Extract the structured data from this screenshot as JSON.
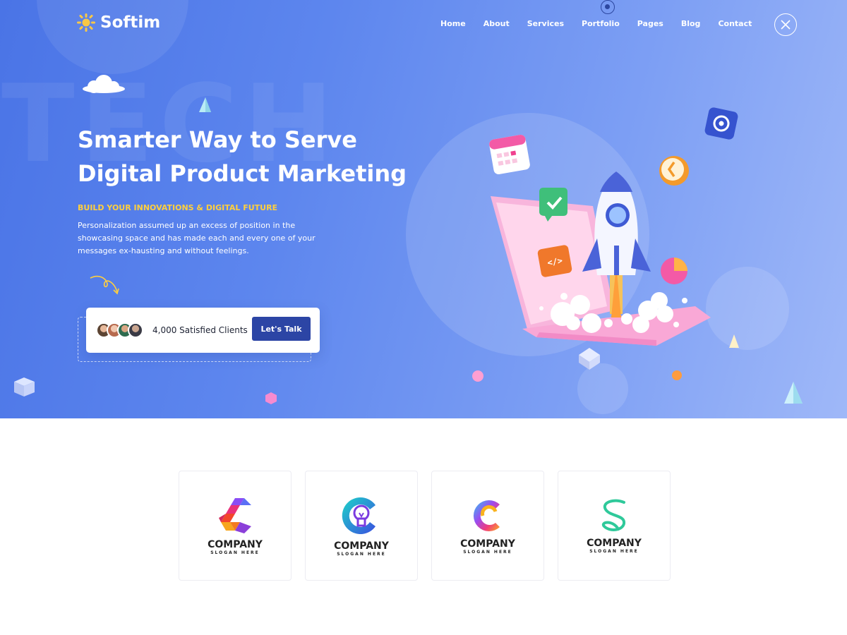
{
  "header": {
    "logo_text": "Softim",
    "nav": [
      "Home",
      "About",
      "Services",
      "Portfolio",
      "Pages",
      "Blog",
      "Contact"
    ]
  },
  "hero": {
    "bg_word": "TECH",
    "headline": "Smarter Way to Serve Digital Product Marketing",
    "tagline": "BUILD YOUR INNOVATIONS & DIGITAL FUTURE",
    "paragraph": "Personalization assumed up an excess of position in the showcasing space and has made each and every one of your messages ex-hausting and without feelings.",
    "clients_text": "4,000 Satisfied Clients",
    "cta_label": "Let's Talk"
  },
  "brands": [
    {
      "name": "COMPANY",
      "slogan": "SLOGAN HERE",
      "icon": "hexagon-c-logo-icon"
    },
    {
      "name": "COMPANY",
      "slogan": "SLOGAN HERE",
      "icon": "lightbulb-c-logo-icon"
    },
    {
      "name": "COMPANY",
      "slogan": "SLOGAN HERE",
      "icon": "swirl-c-logo-icon"
    },
    {
      "name": "COMPANY",
      "slogan": "SLOGAN HERE",
      "icon": "ribbon-s-logo-icon"
    }
  ],
  "colors": {
    "hero_gradient_start": "#4a74e6",
    "hero_gradient_end": "#9fb8f8",
    "accent_yellow": "#ffcf3d",
    "button_blue": "#2c45a5"
  }
}
